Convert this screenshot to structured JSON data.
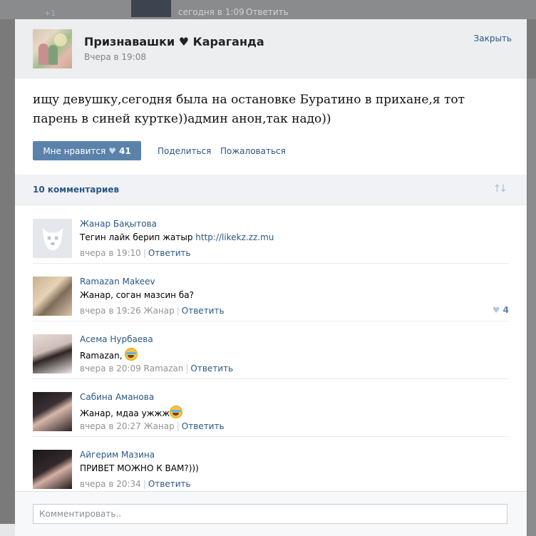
{
  "background": {
    "time": "сегодня в 1:09",
    "reply": "Ответить",
    "plus": "+1"
  },
  "post": {
    "group_name": "Признавашки ♥ Караганда",
    "date": "Вчера в 19:08",
    "close_label": "Закрыть",
    "text": "ищу девушку,сегодня была на остановке Буратино в прихане,я тот парень в синей куртке))админ анон,так надо))",
    "like_label": "Мне нравится",
    "like_count": "41",
    "share_label": "Поделиться",
    "report_label": "Пожаловаться"
  },
  "comments_header": {
    "count_label": "10 комментариев"
  },
  "comments": [
    {
      "author": "Жанар Бақытова",
      "text": "Тегин лайк берип жатыр ",
      "link": "http://likekz.zz.mu",
      "time": "вчера в 19:10",
      "reply_to": "",
      "reply": "Ответить",
      "likes": ""
    },
    {
      "author": "Ramazan Makeev",
      "text": "Жанар, соган мазсин ба?",
      "link": "",
      "time": "вчера в 19:26",
      "reply_to": "Жанар",
      "reply": "Ответить",
      "likes": "4"
    },
    {
      "author": "Асема Нурбаева",
      "text": "Ramazan, ",
      "link": "",
      "time": "вчера в 20:09",
      "reply_to": "Ramazan",
      "reply": "Ответить",
      "likes": ""
    },
    {
      "author": "Сабина Аманова",
      "text": "Жанар, мдаа ужжж",
      "link": "",
      "time": "вчера в 20:27",
      "reply_to": "Жанар",
      "reply": "Ответить",
      "likes": ""
    },
    {
      "author": "Айгерим Мазина",
      "text": "ПРИВЕТ МОЖНО К ВАМ?)))",
      "link": "",
      "time": "вчера в 20:34",
      "reply_to": "",
      "reply": "Ответить",
      "likes": ""
    }
  ],
  "input": {
    "placeholder": "Комментировать.."
  },
  "icons": {
    "like": "heart-icon",
    "sort": "sort-arrows-icon",
    "emoji": "tears-of-joy-emoji-icon",
    "deactivated_avatar": "dog-face-icon"
  }
}
